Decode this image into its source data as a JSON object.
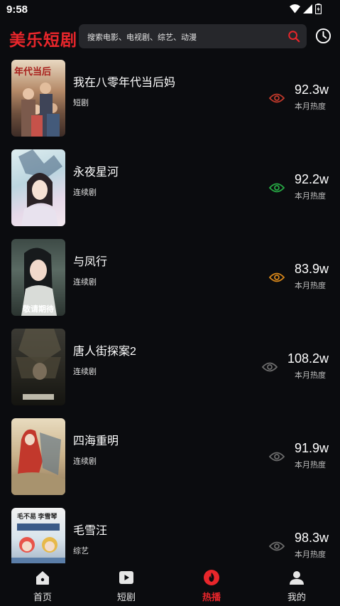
{
  "status_bar": {
    "time": "9:58"
  },
  "header": {
    "logo_text": "美乐短剧",
    "search_placeholder": "搜索电影、电视剧、综艺、动漫"
  },
  "colors": {
    "accent": "#e8262b",
    "background": "#0b0c0f",
    "search_bg": "#26272b"
  },
  "list": {
    "items": [
      {
        "title": "我在八零年代当后妈",
        "genre": "短剧",
        "heat": "92.3w",
        "heat_label": "本月热度",
        "eye_color": "#c0392b",
        "poster_text": "年代当后"
      },
      {
        "title": "永夜星河",
        "genre": "连续剧",
        "heat": "92.2w",
        "heat_label": "本月热度",
        "eye_color": "#27a844",
        "poster_text": ""
      },
      {
        "title": "与凤行",
        "genre": "连续剧",
        "heat": "83.9w",
        "heat_label": "本月热度",
        "eye_color": "#d6861a",
        "poster_text": "敬请期待"
      },
      {
        "title": "唐人街探案2",
        "genre": "连续剧",
        "heat": "108.2w",
        "heat_label": "本月热度",
        "eye_color": "#6b6b6b",
        "poster_text": ""
      },
      {
        "title": "四海重明",
        "genre": "连续剧",
        "heat": "91.9w",
        "heat_label": "本月热度",
        "eye_color": "#6b6b6b",
        "poster_text": ""
      },
      {
        "title": "毛雪汪",
        "genre": "综艺",
        "heat": "98.3w",
        "heat_label": "本月热度",
        "eye_color": "#6b6b6b",
        "poster_text": "毛不易 李雪琴"
      }
    ]
  },
  "tabbar": {
    "tabs": [
      {
        "label": "首页",
        "icon": "home-icon",
        "active": false
      },
      {
        "label": "短剧",
        "icon": "play-icon",
        "active": false
      },
      {
        "label": "热播",
        "icon": "fire-icon",
        "active": true
      },
      {
        "label": "我的",
        "icon": "user-icon",
        "active": false
      }
    ]
  }
}
